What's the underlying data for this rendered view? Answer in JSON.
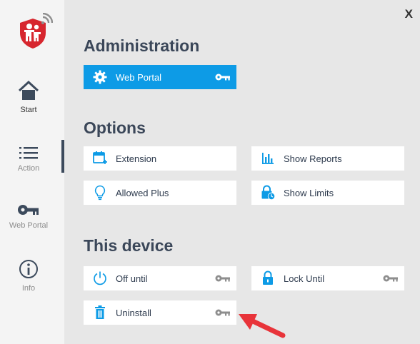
{
  "window": {
    "close_label": "X"
  },
  "sidebar": {
    "items": [
      {
        "label": "Start",
        "icon": "home-icon",
        "active": true
      },
      {
        "label": "Action",
        "icon": "list-icon",
        "active": false
      },
      {
        "label": "Web Portal",
        "icon": "key-icon",
        "active": false
      },
      {
        "label": "Info",
        "icon": "info-icon",
        "active": false
      }
    ]
  },
  "sections": {
    "administration": {
      "title": "Administration",
      "items": [
        {
          "label": "Web Portal",
          "icon": "gear-icon",
          "requires_key": true
        }
      ]
    },
    "options": {
      "title": "Options",
      "items": [
        {
          "label": "Extension",
          "icon": "calendar-plus-icon"
        },
        {
          "label": "Show Reports",
          "icon": "bar-chart-icon"
        },
        {
          "label": "Allowed Plus",
          "icon": "lightbulb-icon"
        },
        {
          "label": "Show Limits",
          "icon": "lock-clock-icon"
        }
      ]
    },
    "this_device": {
      "title": "This device",
      "items": [
        {
          "label": "Off until",
          "icon": "power-icon",
          "requires_key": true
        },
        {
          "label": "Lock Until",
          "icon": "lock-icon",
          "requires_key": true
        },
        {
          "label": "Uninstall",
          "icon": "trash-icon",
          "requires_key": true
        }
      ]
    }
  },
  "colors": {
    "accent": "#0d9be6",
    "brand_red": "#d7262e",
    "title_text": "#3b4759",
    "annotation_arrow": "#e8343a"
  }
}
